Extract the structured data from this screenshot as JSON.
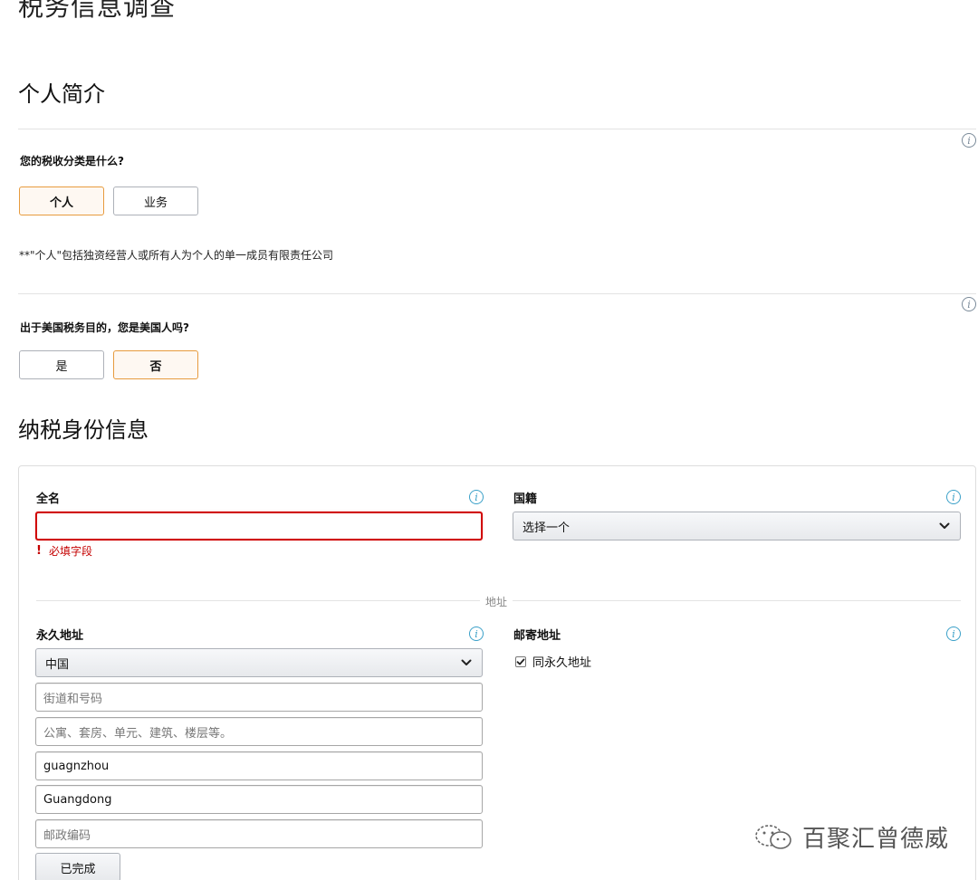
{
  "page_title": "税务信息调查",
  "sections": {
    "profile_title": "个人简介",
    "tax_identity_title": "纳税身份信息"
  },
  "tax_classification": {
    "question": "您的税收分类是什么?",
    "options": [
      "个人",
      "业务"
    ],
    "selected": "个人",
    "note": "**\"个人\"包括独资经营人或所有人为个人的单一成员有限责任公司"
  },
  "us_person": {
    "question": "出于美国税务目的，您是美国人吗?",
    "options": [
      "是",
      "否"
    ],
    "selected": "否"
  },
  "form": {
    "full_name": {
      "label": "全名",
      "value": "",
      "error": "必填字段"
    },
    "nationality": {
      "label": "国籍",
      "selected": "选择一个"
    },
    "address_divider": "地址",
    "permanent_address": {
      "label": "永久地址",
      "country": "中国",
      "street_placeholder": "街道和号码",
      "apt_placeholder": "公寓、套房、单元、建筑、楼层等。",
      "city": "guagnzhou",
      "state": "Guangdong",
      "postal_placeholder": "邮政编码",
      "done_button": "已完成"
    },
    "mailing_address": {
      "label": "邮寄地址",
      "same_as_permanent": "同永久地址",
      "checked": true
    }
  },
  "watermark": "百聚汇曾德威",
  "colors": {
    "selected_border": "#e79b3e",
    "selected_bg": "#fef8f2",
    "error": "#d00000",
    "info_icon": "#3aa0c8"
  }
}
